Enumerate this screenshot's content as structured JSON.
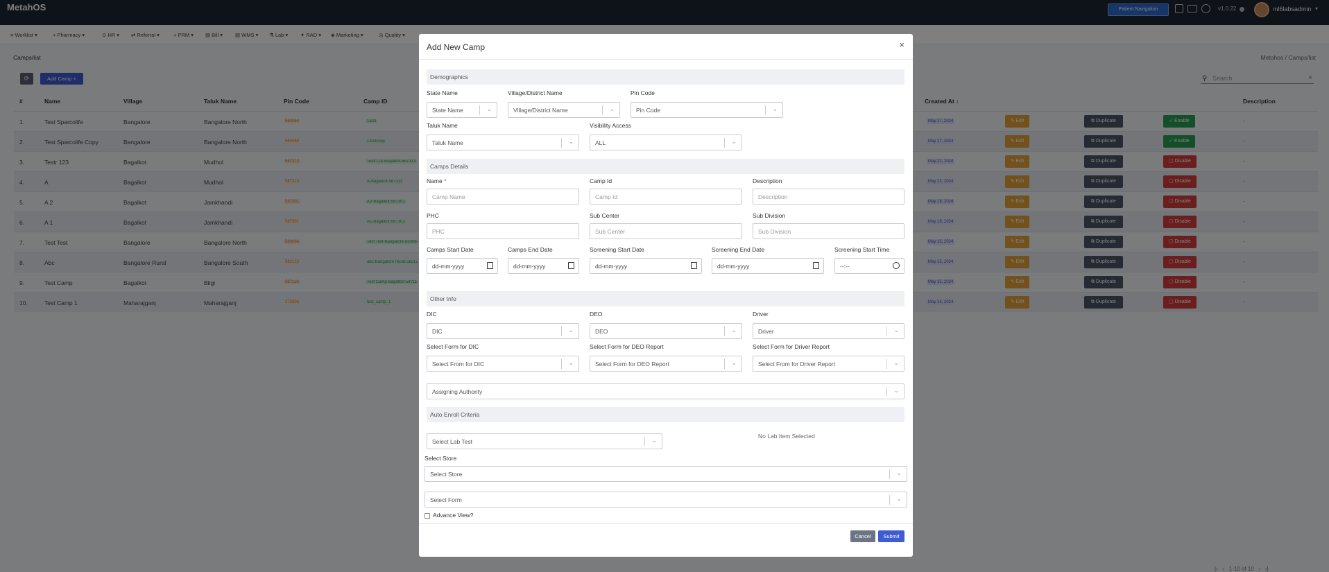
{
  "app": {
    "name": "MetahOS",
    "patient_nav": "Patient Navigation",
    "version": "v1.0.22",
    "username": "ml6labsadmin"
  },
  "menu": [
    "Worklist",
    "Pharmacy",
    "HR",
    "Referral",
    "PRM",
    "Bill",
    "WMS",
    "Lab",
    "RAD",
    "Marketing",
    "Quality"
  ],
  "breadcrumb": {
    "left": "Camps/list",
    "root": "Metahos",
    "current": "Camps/list"
  },
  "toolbar": {
    "add_camp": "Add Camp",
    "search_placeholder": "Search"
  },
  "table": {
    "headers": {
      "num": "#",
      "name": "Name",
      "village": "Village",
      "taluk": "Taluk Name",
      "pin": "Pin Code",
      "camp_id": "Camp ID",
      "created": "Created At",
      "description": "Description"
    },
    "rows": [
      {
        "num": "1.",
        "name": "Test Sparcolife",
        "village": "Bangalore",
        "taluk": "Bangalore North",
        "pin": "560064",
        "camp_id": "1333",
        "created": "May 17, 2024",
        "status": "Enable",
        "desc": "-"
      },
      {
        "num": "2.",
        "name": "Test Sparcolife Copy",
        "village": "Bangalore",
        "taluk": "Bangalore North",
        "pin": "560064",
        "camp_id": "1333copy",
        "created": "May 17, 2024",
        "status": "Enable",
        "desc": "-"
      },
      {
        "num": "3.",
        "name": "Testr 123",
        "village": "Bagalkot",
        "taluk": "Mudhol",
        "pin": "587313",
        "camp_id": "Testr123-Bagalkot-587313",
        "created": "May 22, 2024",
        "status": "Disable",
        "desc": "-"
      },
      {
        "num": "4.",
        "name": "A",
        "village": "Bagalkot",
        "taluk": "Mudhol",
        "pin": "587313",
        "camp_id": "A-Bagalkot-587313",
        "created": "May 22, 2024",
        "status": "Disable",
        "desc": "-"
      },
      {
        "num": "5.",
        "name": "A 2",
        "village": "Bagalkot",
        "taluk": "Jamkhandi",
        "pin": "587301",
        "camp_id": "A2-Bagalkot-587301",
        "created": "May 18, 2024",
        "status": "Disable",
        "desc": "-"
      },
      {
        "num": "6.",
        "name": "A 1",
        "village": "Bagalkot",
        "taluk": "Jamkhandi",
        "pin": "587301",
        "camp_id": "A1-Bagalkot-587301",
        "created": "May 18, 2024",
        "status": "Disable",
        "desc": "-"
      },
      {
        "num": "7.",
        "name": "Test Test",
        "village": "Bangalore",
        "taluk": "Bangalore North",
        "pin": "560064",
        "camp_id": "Test Test-Bangalore-560064",
        "created": "May 15, 2024",
        "status": "Disable",
        "desc": "-"
      },
      {
        "num": "8.",
        "name": "Abc",
        "village": "Bangalore Rural",
        "taluk": "Bangalore South",
        "pin": "562123",
        "camp_id": "abc-Bangalore Rural-562123",
        "created": "May 15, 2024",
        "status": "Disable",
        "desc": "-"
      },
      {
        "num": "9.",
        "name": "Test Camp",
        "village": "Bagalkot",
        "taluk": "Bilgi",
        "pin": "587116",
        "camp_id": "Test Camp-Bagalkot-587116",
        "created": "May 15, 2024",
        "status": "Disable",
        "desc": "-"
      },
      {
        "num": "10.",
        "name": "Test Camp 1",
        "village": "Maharajganj",
        "taluk": "Maharajganj",
        "pin": "273303",
        "camp_id": "test_camp_1",
        "created": "May 14, 2024",
        "status": "Disable",
        "desc": "-"
      }
    ],
    "edit_label": "Edit",
    "duplicate_label": "Duplicate"
  },
  "pagination": {
    "text": "1-10 of 10"
  },
  "modal": {
    "title": "Add New Camp",
    "sections": {
      "demographics": "Demographics",
      "camp_details": "Camps Details",
      "other_info": "Other Info",
      "auto_enroll": "Auto Enroll Criteria"
    },
    "labels": {
      "state": "State Name",
      "village": "Village/District Name",
      "pin": "Pin Code",
      "taluk": "Taluk Name",
      "visibility": "Visibility Access",
      "name": "Name",
      "camp_id": "Camp Id",
      "description": "Description",
      "phc": "PHC",
      "sub_center": "Sub Center",
      "sub_division": "Sub Division",
      "start_date": "Camps Start Date",
      "end_date": "Camps End Date",
      "scr_start_date": "Screening Start Date",
      "scr_end_date": "Screening End Date",
      "scr_start_time": "Screening Start Time",
      "dic": "DIC",
      "deo": "DEO",
      "driver": "Driver",
      "form_dic": "Select Form for DIC",
      "form_deo": "Select Form for DEO Report",
      "form_driver": "Select Form for Driver Report",
      "select_store": "Select Store",
      "advance_view": "Advance View?"
    },
    "placeholders": {
      "state": "State Name",
      "village": "Village/District Name",
      "pin": "Pin Code",
      "taluk": "Taluk Name",
      "visibility": "ALL",
      "name": "Camp Name",
      "camp_id": "Camp Id",
      "description": "Description",
      "phc": "PHC",
      "sub_center": "Sub Center",
      "sub_division": "Sub Division",
      "date": "dd-mm-yyyy",
      "time": "--:--",
      "dic": "DIC",
      "deo": "DEO",
      "driver": "Driver",
      "form_dic": "Select From for DIC",
      "form_deo": "Select Form for DEO Report",
      "form_driver": "Select From for Driver Report",
      "assigning_authority": "Assigning Authority",
      "lab_test": "Select Lab Test",
      "store": "Select Store",
      "form": "Select Form"
    },
    "no_lab_item": "No Lab Item Selected",
    "cancel": "Cancel",
    "submit": "Submit"
  }
}
